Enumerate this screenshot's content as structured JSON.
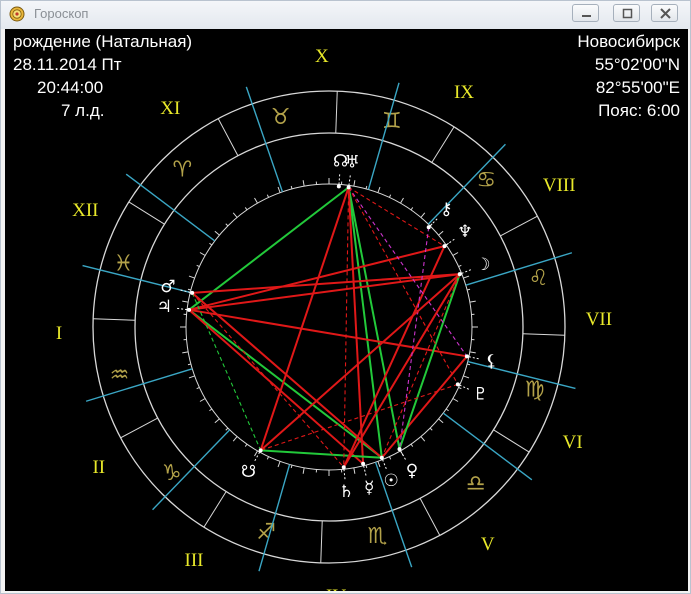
{
  "window": {
    "title": "Гороскоп",
    "controls": [
      "minimize",
      "maximize",
      "close"
    ]
  },
  "chart_info": {
    "chart_type": "рождение (Натальная)",
    "date": "28.11.2014 Пт",
    "time": "20:44:00",
    "lunar_day": "7 л.д."
  },
  "location": {
    "city": "Новосибирск",
    "latitude": "55°02'00\"N",
    "longitude": "82°55'00\"E",
    "timezone": "Пояс: 6:00"
  },
  "houses": [
    {
      "numeral": "I",
      "cusp_deg": 166
    },
    {
      "numeral": "II",
      "cusp_deg": 197
    },
    {
      "numeral": "III",
      "cusp_deg": 226
    },
    {
      "numeral": "IV",
      "cusp_deg": 254
    },
    {
      "numeral": "V",
      "cusp_deg": 289
    },
    {
      "numeral": "VI",
      "cusp_deg": 323
    },
    {
      "numeral": "VII",
      "cusp_deg": 346
    },
    {
      "numeral": "VIII",
      "cusp_deg": 17
    },
    {
      "numeral": "IX",
      "cusp_deg": 46
    },
    {
      "numeral": "X",
      "cusp_deg": 74
    },
    {
      "numeral": "XI",
      "cusp_deg": 109
    },
    {
      "numeral": "XII",
      "cusp_deg": 143
    }
  ],
  "zodiac": [
    {
      "sign": "Taurus",
      "glyph": "♉"
    },
    {
      "sign": "Aries",
      "glyph": "♈"
    },
    {
      "sign": "Pisces",
      "glyph": "♓"
    },
    {
      "sign": "Aquarius",
      "glyph": "♒"
    },
    {
      "sign": "Capricorn",
      "glyph": "♑"
    },
    {
      "sign": "Sagittarius",
      "glyph": "♐"
    },
    {
      "sign": "Scorpio",
      "glyph": "♏"
    },
    {
      "sign": "Libra",
      "glyph": "♎"
    },
    {
      "sign": "Virgo",
      "glyph": "♍"
    },
    {
      "sign": "Leo",
      "glyph": "♌"
    },
    {
      "sign": "Cancer",
      "glyph": "♋"
    },
    {
      "sign": "Gemini",
      "glyph": "♊"
    }
  ],
  "planets": [
    {
      "name": "North Node",
      "glyph": "☊",
      "deg": 86
    },
    {
      "name": "Uranus",
      "glyph": "♅",
      "deg": 82
    },
    {
      "name": "Chiron",
      "glyph": "⚷",
      "deg": 45
    },
    {
      "name": "Neptune",
      "glyph": "♆",
      "deg": 35
    },
    {
      "name": "Moon",
      "glyph": "☽",
      "deg": 22
    },
    {
      "name": "Lilith",
      "glyph": "⚸",
      "deg": 348
    },
    {
      "name": "Pluto",
      "glyph": "♇",
      "deg": 336
    },
    {
      "name": "Venus",
      "glyph": "♀",
      "deg": 300
    },
    {
      "name": "Sun",
      "glyph": "☉",
      "deg": 292
    },
    {
      "name": "Mercury",
      "glyph": "☿",
      "deg": 284
    },
    {
      "name": "Saturn",
      "glyph": "♄",
      "deg": 276
    },
    {
      "name": "South Node",
      "glyph": "☋",
      "deg": 241
    },
    {
      "name": "Jupiter",
      "glyph": "♃",
      "deg": 173
    },
    {
      "name": "Mars",
      "glyph": "♂",
      "deg": 166
    }
  ],
  "aspects": [
    {
      "a": "Jupiter",
      "b": "Uranus",
      "color": "#22c93a",
      "style": "solid"
    },
    {
      "a": "Jupiter",
      "b": "Sun",
      "color": "#22c93a",
      "style": "solid"
    },
    {
      "a": "Uranus",
      "b": "Sun",
      "color": "#22c93a",
      "style": "solid"
    },
    {
      "a": "Uranus",
      "b": "Venus",
      "color": "#22c93a",
      "style": "solid"
    },
    {
      "a": "Jupiter",
      "b": "Moon",
      "color": "#e01818",
      "style": "solid"
    },
    {
      "a": "Jupiter",
      "b": "Lilith",
      "color": "#e01818",
      "style": "solid"
    },
    {
      "a": "Jupiter",
      "b": "Neptune",
      "color": "#e01818",
      "style": "solid"
    },
    {
      "a": "Jupiter",
      "b": "Mercury",
      "color": "#e01818",
      "style": "solid"
    },
    {
      "a": "Mars",
      "b": "Moon",
      "color": "#e01818",
      "style": "solid"
    },
    {
      "a": "Mars",
      "b": "Sun",
      "color": "#e01818",
      "style": "solid"
    },
    {
      "a": "Uranus",
      "b": "Mercury",
      "color": "#e01818",
      "style": "solid"
    },
    {
      "a": "South Node",
      "b": "Moon",
      "color": "#e01818",
      "style": "solid"
    },
    {
      "a": "South Node",
      "b": "Uranus",
      "color": "#e01818",
      "style": "solid"
    },
    {
      "a": "South Node",
      "b": "Sun",
      "color": "#22c93a",
      "style": "solid"
    },
    {
      "a": "Saturn",
      "b": "Moon",
      "color": "#e01818",
      "style": "solid"
    },
    {
      "a": "Saturn",
      "b": "Neptune",
      "color": "#e01818",
      "style": "solid"
    },
    {
      "a": "Sun",
      "b": "Lilith",
      "color": "#e01818",
      "style": "solid"
    },
    {
      "a": "Venus",
      "b": "Moon",
      "color": "#22c93a",
      "style": "solid"
    },
    {
      "a": "Mars",
      "b": "South Node",
      "color": "#22c93a",
      "style": "dashed"
    },
    {
      "a": "Uranus",
      "b": "Saturn",
      "color": "#e01818",
      "style": "dashed"
    },
    {
      "a": "Uranus",
      "b": "Neptune",
      "color": "#e01818",
      "style": "dashed"
    },
    {
      "a": "Chiron",
      "b": "Venus",
      "color": "#cc33cc",
      "style": "dashed"
    },
    {
      "a": "Uranus",
      "b": "Lilith",
      "color": "#cc33cc",
      "style": "dashed"
    },
    {
      "a": "Pluto",
      "b": "South Node",
      "color": "#e01818",
      "style": "dashed"
    },
    {
      "a": "Mars",
      "b": "Saturn",
      "color": "#e01818",
      "style": "dashed"
    },
    {
      "a": "Moon",
      "b": "Sun",
      "color": "#e01818",
      "style": "dashed"
    },
    {
      "a": "Uranus",
      "b": "Pluto",
      "color": "#e01818",
      "style": "dashed"
    }
  ],
  "colors": {
    "background": "#000000",
    "wheel_lines": "#d8d8d8",
    "house_cusps": "#3aa6c4",
    "house_numerals": "#e8e82a",
    "sign_glyphs": "#b3a24a",
    "planet_glyphs": "#ffffff",
    "info_text": "#ffffff"
  }
}
